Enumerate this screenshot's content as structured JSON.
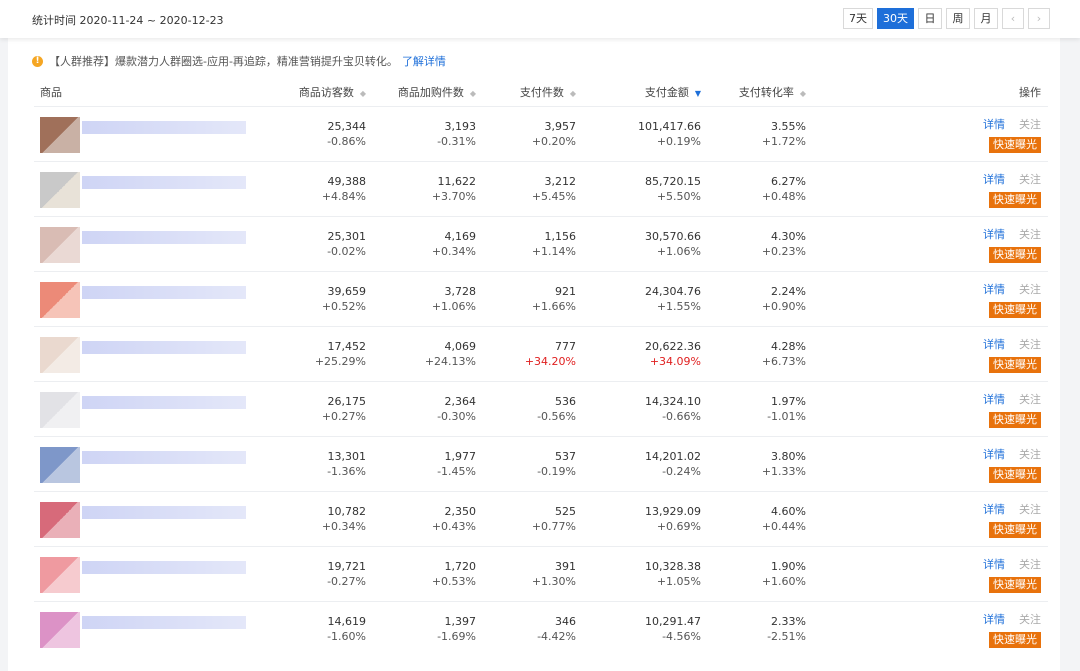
{
  "period": "统计时间 2020-11-24 ~ 2020-12-23",
  "range_buttons": [
    "7天",
    "30天",
    "日",
    "周",
    "月"
  ],
  "active_range": "30天",
  "nav": {
    "prev": "‹",
    "next": "›"
  },
  "notice": {
    "text": "【人群推荐】爆款潜力人群圈选-应用-再追踪，精准营销提升宝贝转化。",
    "link": "了解详情",
    "icon": "warning-icon"
  },
  "columns": {
    "product": "商品",
    "visitors": "商品访客数",
    "cart": "商品加购件数",
    "paid_count": "支付件数",
    "paid_amount": "支付金额",
    "conv_rate": "支付转化率",
    "ops": "操作"
  },
  "sorted_column": "paid_amount",
  "actions": {
    "detail": "详情",
    "follow": "关注",
    "fast": "快速曝光"
  },
  "rows": [
    {
      "thumb": [
        "#a0705a",
        "#c9b1a5"
      ],
      "visitors": "25,344",
      "visitors_d": "-0.86%",
      "cart": "3,193",
      "cart_d": "-0.31%",
      "paid_count": "3,957",
      "paid_count_d": "+0.20%",
      "paid_amount": "101,417.66",
      "paid_amount_d": "+0.19%",
      "rate": "3.55%",
      "rate_d": "+1.72%"
    },
    {
      "thumb": [
        "#c9c9c9",
        "#e8e2d8"
      ],
      "visitors": "49,388",
      "visitors_d": "+4.84%",
      "cart": "11,622",
      "cart_d": "+3.70%",
      "paid_count": "3,212",
      "paid_count_d": "+5.45%",
      "paid_amount": "85,720.15",
      "paid_amount_d": "+5.50%",
      "rate": "6.27%",
      "rate_d": "+0.48%"
    },
    {
      "thumb": [
        "#d9bcb4",
        "#ead9d4"
      ],
      "visitors": "25,301",
      "visitors_d": "-0.02%",
      "cart": "4,169",
      "cart_d": "+0.34%",
      "paid_count": "1,156",
      "paid_count_d": "+1.14%",
      "paid_amount": "30,570.66",
      "paid_amount_d": "+1.06%",
      "rate": "4.30%",
      "rate_d": "+0.23%"
    },
    {
      "thumb": [
        "#ec8a78",
        "#f6c4b8"
      ],
      "visitors": "39,659",
      "visitors_d": "+0.52%",
      "cart": "3,728",
      "cart_d": "+1.06%",
      "paid_count": "921",
      "paid_count_d": "+1.66%",
      "paid_amount": "24,304.76",
      "paid_amount_d": "+1.55%",
      "rate": "2.24%",
      "rate_d": "+0.90%"
    },
    {
      "thumb": [
        "#ead9cf",
        "#f3ebe5"
      ],
      "visitors": "17,452",
      "visitors_d": "+25.29%",
      "cart": "4,069",
      "cart_d": "+24.13%",
      "paid_count": "777",
      "paid_count_d": "+34.20%",
      "paid_amount": "20,622.36",
      "paid_amount_d": "+34.09%",
      "rate": "4.28%",
      "rate_d": "+6.73%",
      "highlight": true
    },
    {
      "thumb": [
        "#e2e2e6",
        "#f0f0f2"
      ],
      "visitors": "26,175",
      "visitors_d": "+0.27%",
      "cart": "2,364",
      "cart_d": "-0.30%",
      "paid_count": "536",
      "paid_count_d": "-0.56%",
      "paid_amount": "14,324.10",
      "paid_amount_d": "-0.66%",
      "rate": "1.97%",
      "rate_d": "-1.01%"
    },
    {
      "thumb": [
        "#7e97c9",
        "#b9c6e0"
      ],
      "visitors": "13,301",
      "visitors_d": "-1.36%",
      "cart": "1,977",
      "cart_d": "-1.45%",
      "paid_count": "537",
      "paid_count_d": "-0.19%",
      "paid_amount": "14,201.02",
      "paid_amount_d": "-0.24%",
      "rate": "3.80%",
      "rate_d": "+1.33%"
    },
    {
      "thumb": [
        "#d76a7a",
        "#eab0b8"
      ],
      "visitors": "10,782",
      "visitors_d": "+0.34%",
      "cart": "2,350",
      "cart_d": "+0.43%",
      "paid_count": "525",
      "paid_count_d": "+0.77%",
      "paid_amount": "13,929.09",
      "paid_amount_d": "+0.69%",
      "rate": "4.60%",
      "rate_d": "+0.44%"
    },
    {
      "thumb": [
        "#ef9aa0",
        "#f6cbcf"
      ],
      "visitors": "19,721",
      "visitors_d": "-0.27%",
      "cart": "1,720",
      "cart_d": "+0.53%",
      "paid_count": "391",
      "paid_count_d": "+1.30%",
      "paid_amount": "10,328.38",
      "paid_amount_d": "+1.05%",
      "rate": "1.90%",
      "rate_d": "+1.60%"
    },
    {
      "thumb": [
        "#dc92c6",
        "#eec5e0"
      ],
      "visitors": "14,619",
      "visitors_d": "-1.60%",
      "cart": "1,397",
      "cart_d": "-1.69%",
      "paid_count": "346",
      "paid_count_d": "-4.42%",
      "paid_amount": "10,291.47",
      "paid_amount_d": "-4.56%",
      "rate": "2.33%",
      "rate_d": "-2.51%"
    }
  ]
}
